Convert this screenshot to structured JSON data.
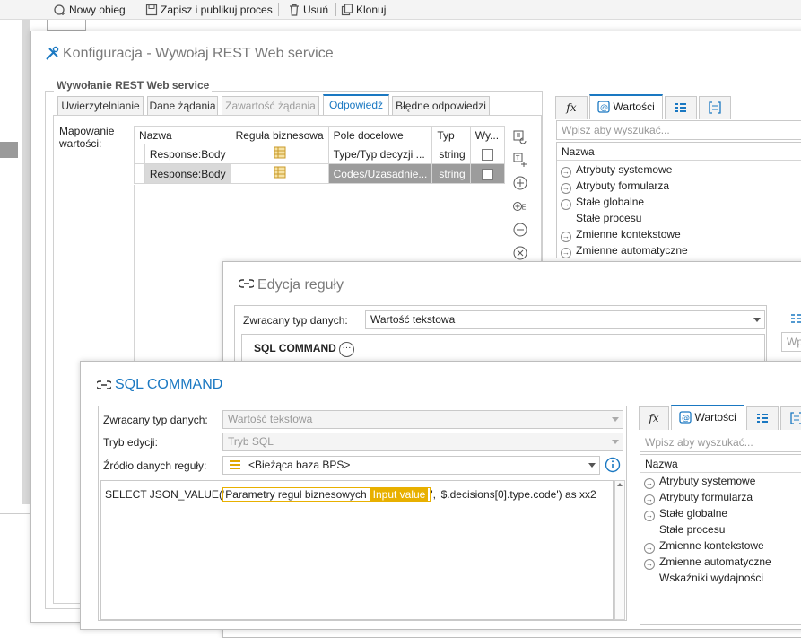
{
  "toolbar": {
    "new_process": "Nowy obieg",
    "save_publish": "Zapisz i publikuj proces",
    "delete": "Usuń",
    "clone": "Klonuj"
  },
  "config_window": {
    "title": "Konfiguracja - Wywołaj REST Web service",
    "group_title": "Wywołanie REST Web service",
    "tabs": [
      "Uwierzytelnianie",
      "Dane żądania",
      "Zawartość żądania",
      "Odpowiedź",
      "Błędne odpowiedzi"
    ],
    "active_tab": "Odpowiedź",
    "mapping_label": "Mapowanie wartości:",
    "columns": [
      "Nazwa",
      "Reguła biznesowa",
      "Pole docelowe",
      "Typ",
      "Wy..."
    ],
    "rows": [
      {
        "name": "Response:Body",
        "target": "Type/Typ decyzji ...",
        "type": "string",
        "selected": false
      },
      {
        "name": "Response:Body",
        "target": "Codes/Uzasadnie...",
        "type": "string",
        "selected": true
      }
    ],
    "right_panel": {
      "tab_fx": "fx",
      "tab_values": "Wartości",
      "search_placeholder": "Wpisz aby wyszukać...",
      "tree_header": "Nazwa",
      "items": [
        "Atrybuty systemowe",
        "Atrybuty formularza",
        "Stałe globalne",
        "Stałe procesu",
        "Zmienne kontekstowe",
        "Zmienne automatyczne"
      ]
    }
  },
  "rule_window": {
    "title": "Edycja reguły",
    "return_type_label": "Zwracany typ danych:",
    "return_type_value": "Wartość tekstowa",
    "function_name": "SQL COMMAND",
    "function_more": "···",
    "side_search_placeholder": "Wpi"
  },
  "sql_window": {
    "title": "SQL COMMAND",
    "return_type_label": "Zwracany typ danych:",
    "return_type_value": "Wartość tekstowa",
    "edit_mode_label": "Tryb edycji:",
    "edit_mode_value": "Tryb SQL",
    "source_label": "Źródło danych reguły:",
    "source_value": "<Bieżąca baza BPS>",
    "sql_prefix": "SELECT JSON_VALUE('",
    "chip_label": "Parametry reguł biznesowych",
    "chip_value": "Input value",
    "sql_suffix": "', '$.decisions[0].type.code') as xx2",
    "right_panel": {
      "tab_fx": "fx",
      "tab_values": "Wartości",
      "search_placeholder": "Wpisz aby wyszukać...",
      "tree_header": "Nazwa",
      "items": [
        {
          "label": "Atrybuty systemowe",
          "arrow": true
        },
        {
          "label": "Atrybuty formularza",
          "arrow": true
        },
        {
          "label": "Stałe globalne",
          "arrow": true
        },
        {
          "label": "Stałe procesu",
          "arrow": false
        },
        {
          "label": "Zmienne kontekstowe",
          "arrow": true
        },
        {
          "label": "Zmienne automatyczne",
          "arrow": true
        },
        {
          "label": "Wskaźniki wydajności",
          "arrow": false
        }
      ]
    }
  },
  "colors": {
    "accent_blue": "#1a78c2",
    "chip_yellow": "#e8b000",
    "selected_row": "#9c9c9c"
  }
}
